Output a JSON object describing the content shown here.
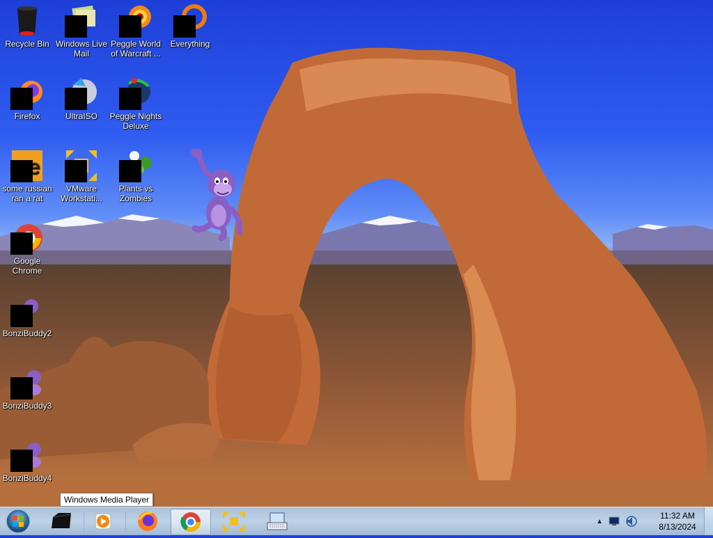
{
  "desktop": {
    "icons": [
      {
        "label": "Recycle Bin",
        "icon": "recycle-bin-icon"
      },
      {
        "label": "Windows Live Mail",
        "icon": "windows-live-mail-icon"
      },
      {
        "label": "Peggle World of Warcraft ...",
        "icon": "peggle-wow-icon"
      },
      {
        "label": "Everything",
        "icon": "everything-icon"
      },
      {
        "label": "Firefox",
        "icon": "firefox-icon"
      },
      {
        "label": "UltraISO",
        "icon": "ultraiso-icon"
      },
      {
        "label": "Peggle Nights Deluxe",
        "icon": "peggle-nights-icon"
      },
      {
        "label": "some russian ran a rat",
        "icon": "app-icon"
      },
      {
        "label": "VMware Workstati...",
        "icon": "vmware-icon"
      },
      {
        "label": "Plants vs Zombies",
        "icon": "pvz-icon"
      },
      {
        "label": "Google Chrome",
        "icon": "chrome-icon"
      },
      {
        "label": "BonziBuddy2",
        "icon": "bonzibuddy-icon"
      },
      {
        "label": "BonziBuddy3",
        "icon": "bonzibuddy-icon"
      },
      {
        "label": "BonziBuddy4",
        "icon": "bonzibuddy-icon"
      }
    ]
  },
  "tooltip": "Windows Media Player",
  "taskbar": {
    "pinned": [
      {
        "name": "start-button",
        "icon": "windows-orb-icon"
      },
      {
        "name": "app",
        "icon": "black-box-icon"
      },
      {
        "name": "windows-media-player",
        "icon": "media-player-icon"
      },
      {
        "name": "firefox",
        "icon": "firefox-icon"
      },
      {
        "name": "google-chrome",
        "icon": "chrome-icon",
        "active": true
      },
      {
        "name": "vmware",
        "icon": "vmware-icon"
      },
      {
        "name": "on-screen-keyboard",
        "icon": "keyboard-icon"
      }
    ],
    "clock": {
      "time": "11:32 AM",
      "date": "8/13/2024"
    }
  },
  "colors": {
    "sky": "#2f5cf0",
    "rock": "#c0703a",
    "taskbar": "#b8d0ea"
  }
}
